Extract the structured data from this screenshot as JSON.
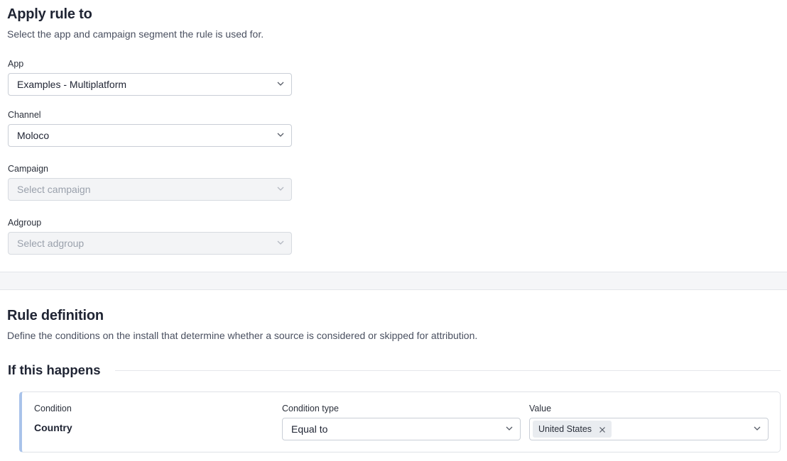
{
  "apply_rule": {
    "title": "Apply rule to",
    "description": "Select the app and campaign segment the rule is used for.",
    "app": {
      "label": "App",
      "value": "Examples - Multiplatform"
    },
    "channel": {
      "label": "Channel",
      "value": "Moloco"
    },
    "campaign": {
      "label": "Campaign",
      "placeholder": "Select campaign"
    },
    "adgroup": {
      "label": "Adgroup",
      "placeholder": "Select adgroup"
    }
  },
  "rule_definition": {
    "title": "Rule definition",
    "description": "Define the conditions on the install that determine whether a source is considered or skipped for attribution.",
    "if_this_happens": "If this happens",
    "condition": {
      "condition_label": "Condition",
      "condition_value": "Country",
      "type_label": "Condition type",
      "type_value": "Equal to",
      "value_label": "Value",
      "chips": [
        "United States"
      ]
    }
  },
  "icons": {
    "chevron": "chevron-down-icon",
    "remove": "close-icon"
  },
  "colors": {
    "accent_border": "#a9c3ea",
    "disabled_bg": "#f3f4f6"
  }
}
